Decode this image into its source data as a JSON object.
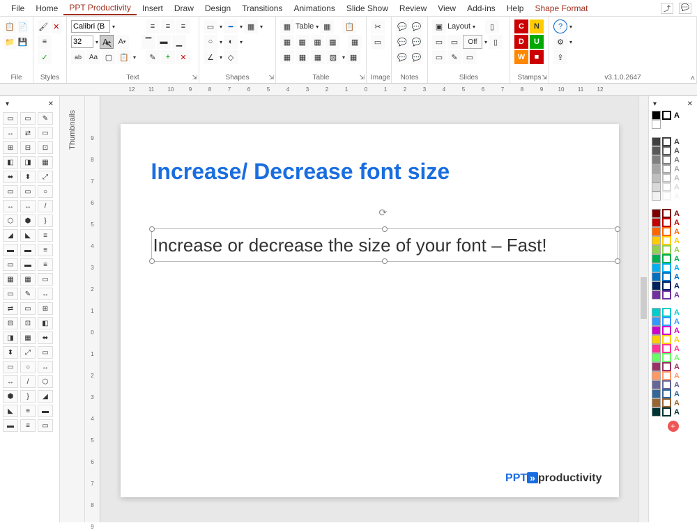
{
  "menubar": {
    "tabs": [
      "File",
      "Home",
      "PPT Productivity",
      "Insert",
      "Draw",
      "Design",
      "Transitions",
      "Animations",
      "Slide Show",
      "Review",
      "View",
      "Add-ins",
      "Help",
      "Shape Format"
    ],
    "active_index": 2,
    "share_icon": "share-icon",
    "comment_icon": "comment-icon"
  },
  "ribbon": {
    "file_group": {
      "label": "File"
    },
    "styles_group": {
      "label": "Styles"
    },
    "text_group": {
      "label": "Text",
      "font_name": "Calibri (B",
      "font_size": "32",
      "increase_font": "A",
      "decrease_font": "A"
    },
    "shapes_group": {
      "label": "Shapes"
    },
    "table_group": {
      "label": "Table",
      "table_btn": "Table"
    },
    "image_group": {
      "label": "Image"
    },
    "notes_group": {
      "label": "Notes"
    },
    "slides_group": {
      "label": "Slides",
      "layout_btn": "Layout",
      "off_btn": "Off"
    },
    "stamps_group": {
      "label": "Stamps",
      "c": "C",
      "n": "N",
      "d": "D",
      "u": "U",
      "w": "W"
    },
    "version_group": {
      "label": "v3.1.0.2647",
      "help_icon": "?"
    }
  },
  "ruler_h": [
    "12",
    "11",
    "10",
    "9",
    "8",
    "7",
    "6",
    "5",
    "4",
    "3",
    "2",
    "1",
    "0",
    "1",
    "2",
    "3",
    "4",
    "5",
    "6",
    "7",
    "8",
    "9",
    "10",
    "11",
    "12"
  ],
  "ruler_v": [
    "9",
    "8",
    "7",
    "6",
    "5",
    "4",
    "3",
    "2",
    "1",
    "0",
    "1",
    "2",
    "3",
    "4",
    "5",
    "6",
    "7",
    "8",
    "9"
  ],
  "thumbnails": {
    "label": "Thumbnails"
  },
  "slide": {
    "title": "Increase/ Decrease font size",
    "body": "Increase or decrease the size of your font – Fast!",
    "logo_ppt": "PPT",
    "logo_arrow": "»",
    "logo_prod": "productivity"
  },
  "right_panel": {
    "colors_top": [
      "#000000",
      "#ffffff"
    ],
    "colors_gray": [
      "#404040",
      "#595959",
      "#808080",
      "#a6a6a6",
      "#bfbfbf",
      "#d9d9d9",
      "#f2f2f2"
    ],
    "colors_theme": [
      "#7f0000",
      "#c00000",
      "#ff6600",
      "#ffcc00",
      "#92d050",
      "#00b050",
      "#00b0f0",
      "#0070c0",
      "#002060",
      "#7030a0"
    ],
    "colors_accent": [
      "#00cccc",
      "#3399ff",
      "#cc00cc",
      "#ffcc00",
      "#ff3399",
      "#66ff66",
      "#993366",
      "#ff9966",
      "#666699",
      "#336699",
      "#996633",
      "#003333"
    ]
  }
}
